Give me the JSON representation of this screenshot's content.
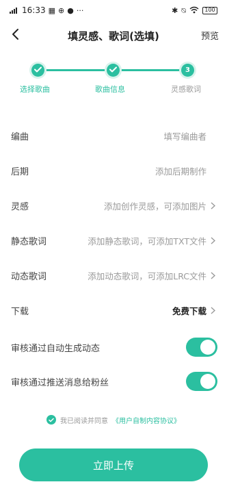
{
  "status_bar": {
    "time": "16:33",
    "battery": "100"
  },
  "header": {
    "title": "填灵感、歌词(选填)",
    "preview_label": "预览"
  },
  "stepper": {
    "steps": [
      {
        "label": "选择歌曲",
        "state": "done"
      },
      {
        "label": "歌曲信息",
        "state": "done"
      },
      {
        "label": "灵感歌词",
        "state": "current",
        "number": "3"
      }
    ],
    "accent_color": "#2bbfa0"
  },
  "form": {
    "rows": [
      {
        "label": "编曲",
        "value": "填写编曲者"
      },
      {
        "label": "后期",
        "value": "添加后期制作"
      },
      {
        "label": "灵感",
        "value": "添加创作灵感，可添加图片"
      },
      {
        "label": "静态歌词",
        "value": "添加静态歌词，可添加TXT文件"
      },
      {
        "label": "动态歌词",
        "value": "添加动态歌词，可添加LRC文件"
      },
      {
        "label": "下载",
        "value": "免费下载"
      }
    ],
    "toggles": [
      {
        "label": "审核通过自动生成动态",
        "on": true
      },
      {
        "label": "审核通过推送消息给粉丝",
        "on": true
      }
    ]
  },
  "agreement": {
    "checked": true,
    "text": "我已阅读并同意",
    "link": "《用户自制内容协议》"
  },
  "upload_button": {
    "label": "立即上传"
  }
}
